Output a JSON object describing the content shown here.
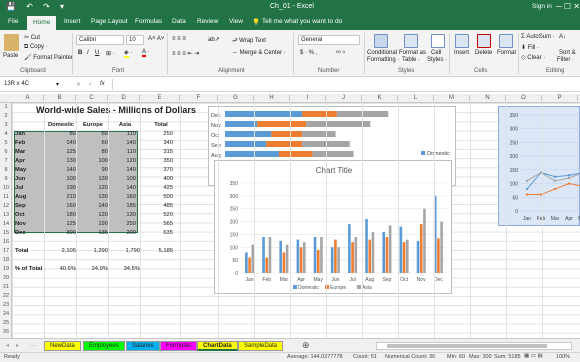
{
  "window": {
    "quick_access": "💾 ↶ ↷ ▾",
    "title": "Ch_01 - Excel",
    "signin": "Sign in",
    "controls": "─ ☐ ✕"
  },
  "tabs": [
    "File",
    "Home",
    "Insert",
    "Page Layout",
    "Formulas",
    "Data",
    "Review",
    "View"
  ],
  "tell_me": "Tell me what you want to do",
  "ribbon": {
    "clipboard": {
      "paste": "Paste",
      "cut": "Cut",
      "copy": "Copy ·",
      "format_painter": "Format Painter",
      "label": "Clipboard"
    },
    "font": {
      "name": "Calibri",
      "size": "10",
      "bold": "B",
      "italic": "I",
      "underline": "U",
      "label": "Font"
    },
    "alignment": {
      "wrap": "Wrap Text",
      "merge": "Merge & Center ·",
      "label": "Alignment"
    },
    "number": {
      "format": "General",
      "currency": "$ · % ,",
      "label": "Number"
    },
    "styles": {
      "cond": "Conditional",
      "cond2": "Formatting ·",
      "table": "Format as",
      "table2": "Table ·",
      "cell": "Cell",
      "cell2": "Styles ·",
      "label": "Styles"
    },
    "cells": {
      "insert": "Insert",
      "delete": "Delete",
      "format": "Format",
      "label": "Cells"
    },
    "editing": {
      "autosum": "AutoSum ·",
      "fill": "Fill ·",
      "clear": "Clear ·",
      "sort": "Sort &",
      "sort2": "Filter ·",
      "label": "Editing"
    }
  },
  "formula_bar": {
    "name_box": "13R x 4C",
    "cancel": "✕",
    "enter": "✓",
    "fx": "fx",
    "value": ""
  },
  "columns": [
    "A",
    "B",
    "C",
    "D",
    "E",
    "F",
    "G",
    "H",
    "I",
    "J",
    "K",
    "L",
    "M",
    "N",
    "O",
    "P",
    "Q",
    "R",
    "S"
  ],
  "rows": [
    "1",
    "2",
    "3",
    "4",
    "5",
    "6",
    "7",
    "8",
    "9",
    "10",
    "11",
    "12",
    "13",
    "14",
    "15",
    "16",
    "17",
    "18",
    "19",
    "20",
    "21",
    "22",
    "23",
    "24",
    "25",
    "26"
  ],
  "table": {
    "title": "World-wide Sales - Millions of Dollars",
    "headers": [
      "Domestic",
      "Europe",
      "Asia",
      "Total"
    ],
    "months": [
      "Jan",
      "Feb",
      "Mar",
      "Apr",
      "May",
      "Jun",
      "Jul",
      "Aug",
      "Sep",
      "Oct",
      "Nov",
      "Dec"
    ],
    "domestic": [
      "80",
      "140",
      "125",
      "130",
      "140",
      "100",
      "190",
      "210",
      "160",
      "180",
      "125",
      "300"
    ],
    "europe": [
      "60",
      "60",
      "80",
      "100",
      "90",
      "130",
      "120",
      "130",
      "140",
      "120",
      "190",
      "135"
    ],
    "asia": [
      "110",
      "140",
      "110",
      "120",
      "140",
      "100",
      "140",
      "160",
      "185",
      "130",
      "250",
      "200"
    ],
    "total": [
      "250",
      "340",
      "315",
      "350",
      "370",
      "400",
      "425",
      "500",
      "485",
      "520",
      "565",
      "635"
    ],
    "total_label": "Total",
    "totals": [
      "2,105",
      "1,290",
      "1,790",
      "5,185"
    ],
    "pct_label": "% of Total",
    "pcts": [
      "40.6%",
      "24.9%",
      "34.5%"
    ]
  },
  "chart_data": [
    {
      "type": "bar",
      "title": "",
      "categories": [
        "Dec",
        "Nov",
        "Oct",
        "Sep",
        "Aug"
      ],
      "series": [
        {
          "name": "Domestic",
          "values": [
            300,
            125,
            180,
            160,
            210
          ]
        },
        {
          "name": "Europe",
          "values": [
            135,
            190,
            120,
            140,
            130
          ]
        },
        {
          "name": "Asia",
          "values": [
            200,
            250,
            130,
            185,
            160
          ]
        }
      ],
      "legend": [
        "Domestic",
        "Europe"
      ],
      "legend_europe_visible": "ope",
      "legend_position": "right"
    },
    {
      "type": "bar",
      "title": "Chart Title",
      "categories": [
        "Jan",
        "Feb",
        "Mar",
        "Apr",
        "May",
        "Jun",
        "Jul",
        "Aug",
        "Sep",
        "Oct",
        "Nov",
        "Dec"
      ],
      "series": [
        {
          "name": "Domestic",
          "values": [
            80,
            140,
            125,
            130,
            140,
            100,
            190,
            210,
            160,
            180,
            125,
            300
          ]
        },
        {
          "name": "Europe",
          "values": [
            60,
            60,
            80,
            100,
            90,
            130,
            120,
            130,
            140,
            120,
            190,
            135
          ]
        },
        {
          "name": "Asia",
          "values": [
            110,
            140,
            110,
            120,
            140,
            100,
            140,
            160,
            185,
            130,
            250,
            200
          ]
        }
      ],
      "ylim": [
        0,
        350
      ],
      "yticks": [
        "0",
        "50",
        "100",
        "150",
        "200",
        "250",
        "300",
        "350"
      ],
      "legend_position": "bottom"
    },
    {
      "type": "line",
      "title": "",
      "categories": [
        "Jan",
        "Feb",
        "Mar",
        "Apr",
        "May"
      ],
      "series": [
        {
          "name": "Domestic",
          "values": [
            80,
            140,
            125,
            130,
            140
          ]
        },
        {
          "name": "Europe",
          "values": [
            60,
            60,
            80,
            100,
            90
          ]
        },
        {
          "name": "Asia",
          "values": [
            110,
            140,
            110,
            120,
            140
          ]
        }
      ],
      "ylim": [
        0,
        350
      ],
      "yticks": [
        "0",
        "50",
        "100",
        "150",
        "200",
        "250",
        "300",
        "350"
      ]
    }
  ],
  "colors": {
    "domestic": "#5b9bd5",
    "europe": "#ed7d31",
    "asia": "#a5a5a5",
    "excel_green": "#217346"
  },
  "sheet_tabs": [
    {
      "label": "NewData",
      "color": "#ffff00"
    },
    {
      "label": "Employees",
      "color": "#00ff00"
    },
    {
      "label": "Salaries",
      "color": "#00b0f0"
    },
    {
      "label": "Formulas",
      "color": "#ff00ff"
    },
    {
      "label": "ChartData",
      "color": "#ffff00"
    },
    {
      "label": "SampleData",
      "color": "#ffff00"
    }
  ],
  "status": {
    "ready": "Ready",
    "average": "Average: 144.0277778",
    "count": "Count: 51",
    "numcount": "Numerical Count: 36",
    "min": "Min: 60",
    "max": "Max: 300",
    "sum": "Sum: 5185",
    "zoom": "100%"
  }
}
